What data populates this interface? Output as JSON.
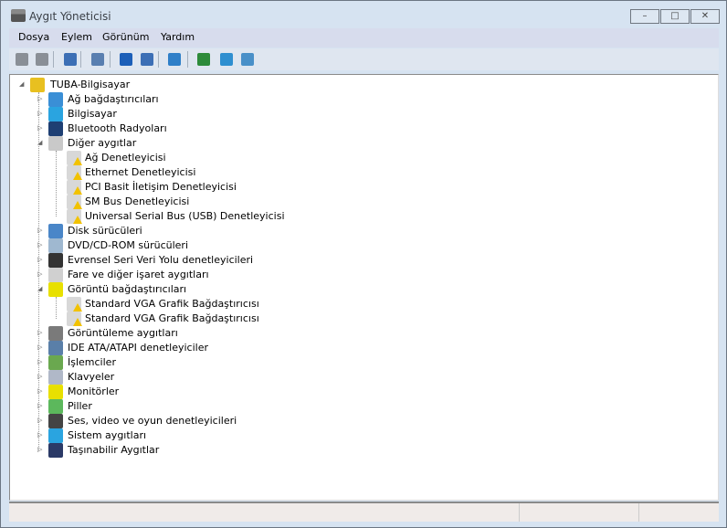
{
  "window": {
    "title": "Aygıt Yöneticisi",
    "minimize": "–",
    "maximize": "□",
    "close": "✕"
  },
  "menu": [
    "Dosya",
    "Eylem",
    "Görünüm",
    "Yardım"
  ],
  "toolbar": [
    "back-icon",
    "forward-icon",
    "show-hide-console-tree-icon",
    "properties-icon",
    "help-icon",
    "action-pane-icon",
    "scan-hardware-icon",
    "update-driver-icon",
    "disable-device-icon",
    "uninstall-device-icon"
  ],
  "tree": {
    "root": "TUBA-Bilgisayar",
    "categories": [
      {
        "label": "Ağ bağdaştırıcıları",
        "icon": "network-adapter-icon",
        "color": "#3a8fd6"
      },
      {
        "label": "Bilgisayar",
        "icon": "computer-icon",
        "color": "#2aa4e0"
      },
      {
        "label": "Bluetooth Radyoları",
        "icon": "bluetooth-icon",
        "color": "#1e3f73"
      },
      {
        "label": "Diğer aygıtlar",
        "icon": "other-devices-icon",
        "color": "#c9c9c9",
        "expanded": true,
        "children": [
          "Ağ Denetleyicisi",
          "Ethernet Denetleyicisi",
          "PCI Basit İletişim Denetleyicisi",
          "SM Bus Denetleyicisi",
          "Universal Serial Bus (USB) Denetleyicisi"
        ]
      },
      {
        "label": "Disk sürücüleri",
        "icon": "disk-drive-icon",
        "color": "#4a86c8"
      },
      {
        "label": "DVD/CD-ROM sürücüleri",
        "icon": "dvd-drive-icon",
        "color": "#9fb8d0"
      },
      {
        "label": "Evrensel Seri Veri Yolu denetleyicileri",
        "icon": "usb-icon",
        "color": "#333333"
      },
      {
        "label": "Fare ve diğer işaret aygıtları",
        "icon": "mouse-icon",
        "color": "#d0d0d0"
      },
      {
        "label": "Görüntü bağdaştırıcıları",
        "icon": "display-adapter-icon",
        "color": "#e8e000",
        "expanded": true,
        "children": [
          "Standard VGA Grafik Bağdaştırıcısı",
          "Standard VGA Grafik Bağdaştırıcısı"
        ]
      },
      {
        "label": "Görüntüleme aygıtları",
        "icon": "imaging-device-icon",
        "color": "#7a7a7a"
      },
      {
        "label": "IDE ATA/ATAPI denetleyiciler",
        "icon": "ide-controller-icon",
        "color": "#5a7fa8"
      },
      {
        "label": "İşlemciler",
        "icon": "processor-icon",
        "color": "#6aa84f"
      },
      {
        "label": "Klavyeler",
        "icon": "keyboard-icon",
        "color": "#b0b8c8"
      },
      {
        "label": "Monitörler",
        "icon": "monitor-icon",
        "color": "#e8e000"
      },
      {
        "label": "Piller",
        "icon": "battery-icon",
        "color": "#5cb85c"
      },
      {
        "label": "Ses, video ve oyun denetleyicileri",
        "icon": "sound-icon",
        "color": "#444444"
      },
      {
        "label": "Sistem aygıtları",
        "icon": "system-devices-icon",
        "color": "#2aa4e0"
      },
      {
        "label": "Taşınabilir Aygıtlar",
        "icon": "portable-devices-icon",
        "color": "#2b3a67"
      }
    ]
  },
  "colors": {
    "warning": "#f2c200",
    "frame": "#d6e3f1",
    "menubar": "#d7dced"
  }
}
